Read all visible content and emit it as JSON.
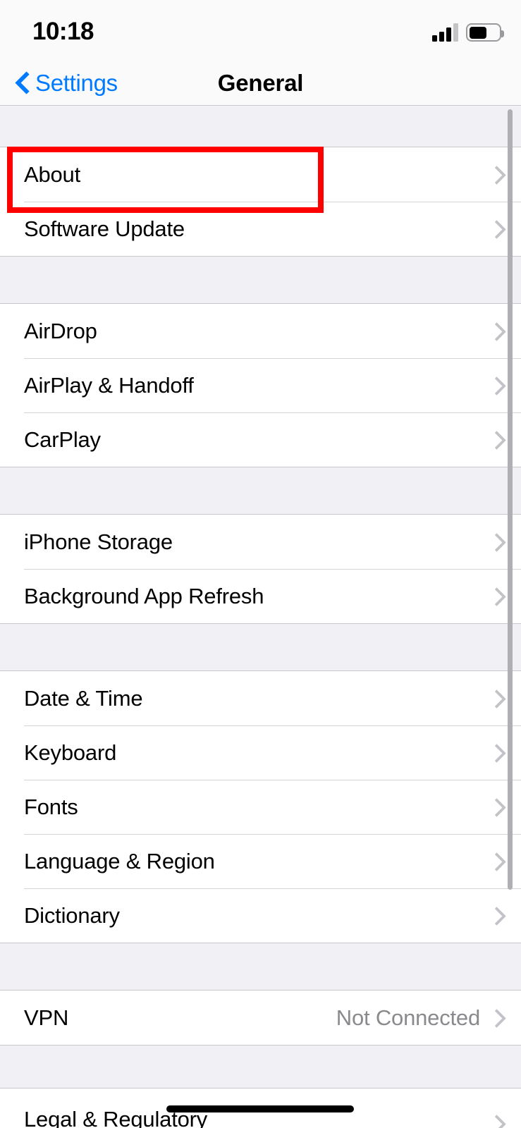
{
  "status_bar": {
    "time": "10:18",
    "signal_icon": "cellular-signal-icon",
    "signal_bars_total": 4,
    "signal_bars_active": 3,
    "battery_icon": "battery-icon",
    "battery_percent": 53
  },
  "nav_bar": {
    "back_icon": "chevron-left-icon",
    "back_label": "Settings",
    "title": "General"
  },
  "highlight": {
    "target_row": "About",
    "color": "#ff0000"
  },
  "colors": {
    "accent_blue": "#007AFF",
    "group_background": "#f1f0f5",
    "separator": "#c8c7cc",
    "secondary_text": "#8a8a8e",
    "chevron": "#c3c3c7"
  },
  "sections": [
    {
      "rows": [
        {
          "label": "About",
          "value": "",
          "chevron_icon": "chevron-right-icon",
          "highlighted": true
        },
        {
          "label": "Software Update",
          "value": "",
          "chevron_icon": "chevron-right-icon",
          "highlighted": false
        }
      ]
    },
    {
      "rows": [
        {
          "label": "AirDrop",
          "value": "",
          "chevron_icon": "chevron-right-icon",
          "highlighted": false
        },
        {
          "label": "AirPlay & Handoff",
          "value": "",
          "chevron_icon": "chevron-right-icon",
          "highlighted": false
        },
        {
          "label": "CarPlay",
          "value": "",
          "chevron_icon": "chevron-right-icon",
          "highlighted": false
        }
      ]
    },
    {
      "rows": [
        {
          "label": "iPhone Storage",
          "value": "",
          "chevron_icon": "chevron-right-icon",
          "highlighted": false
        },
        {
          "label": "Background App Refresh",
          "value": "",
          "chevron_icon": "chevron-right-icon",
          "highlighted": false
        }
      ]
    },
    {
      "rows": [
        {
          "label": "Date & Time",
          "value": "",
          "chevron_icon": "chevron-right-icon",
          "highlighted": false
        },
        {
          "label": "Keyboard",
          "value": "",
          "chevron_icon": "chevron-right-icon",
          "highlighted": false
        },
        {
          "label": "Fonts",
          "value": "",
          "chevron_icon": "chevron-right-icon",
          "highlighted": false
        },
        {
          "label": "Language & Region",
          "value": "",
          "chevron_icon": "chevron-right-icon",
          "highlighted": false
        },
        {
          "label": "Dictionary",
          "value": "",
          "chevron_icon": "chevron-right-icon",
          "highlighted": false
        }
      ]
    },
    {
      "rows": [
        {
          "label": "VPN",
          "value": "Not Connected",
          "chevron_icon": "chevron-right-icon",
          "highlighted": false
        }
      ]
    },
    {
      "rows": [
        {
          "label": "Legal & Regulatory",
          "value": "",
          "chevron_icon": "chevron-right-icon",
          "highlighted": false
        }
      ]
    }
  ]
}
